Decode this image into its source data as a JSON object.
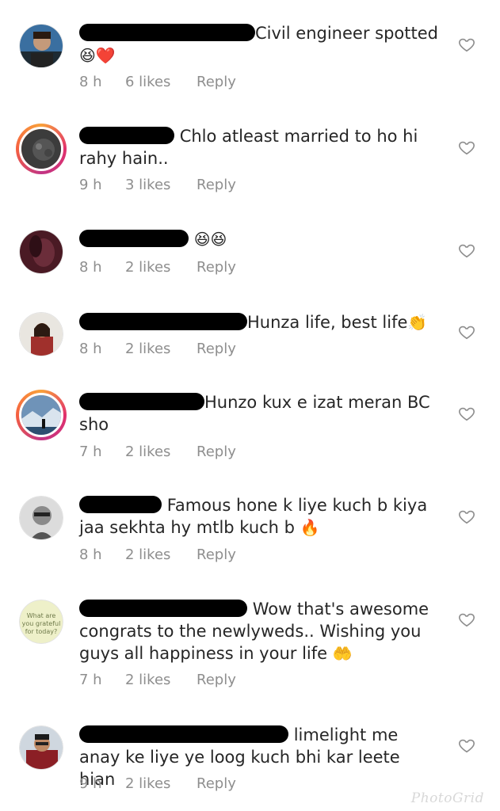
{
  "comments": [
    {
      "text": "Civil engineer spotted",
      "emoji": "😆❤️",
      "time": "8 h",
      "likes": "6 likes",
      "reply": "Reply"
    },
    {
      "text": "Chlo atleast married to ho hi rahy hain..",
      "emoji": "",
      "time": "9 h",
      "likes": "3 likes",
      "reply": "Reply"
    },
    {
      "text": "",
      "emoji": "😆😆",
      "time": "8 h",
      "likes": "2 likes",
      "reply": "Reply"
    },
    {
      "text": "Hunza life, best life",
      "emoji": "👏",
      "time": "8 h",
      "likes": "2 likes",
      "reply": "Reply"
    },
    {
      "text": "Hunzo kux e izat meran BC sho",
      "emoji": "",
      "time": "7 h",
      "likes": "2 likes",
      "reply": "Reply"
    },
    {
      "text": "Famous hone k liye kuch b kiya jaa sekhta hy mtlb kuch b",
      "emoji": "🔥",
      "time": "8 h",
      "likes": "2 likes",
      "reply": "Reply"
    },
    {
      "text": "Wow that's awesome congrats to the newlyweds.. Wishing you guys all happiness in your life",
      "emoji": "🤲",
      "time": "7 h",
      "likes": "2 likes",
      "reply": "Reply"
    },
    {
      "text": "limelight me anay ke liye ye loog kuch bhi kar leete hian",
      "emoji": "",
      "time": "9 h",
      "likes": "2 likes",
      "reply": "Reply"
    }
  ],
  "avatar_texts": [
    "What are",
    "you grateful",
    "for today?"
  ],
  "watermark": "PhotoGrid",
  "icons": {
    "like": "heart-outline-icon"
  },
  "colors": {
    "meta": "#8e8e8e",
    "text": "#262626",
    "ring": "#e1306c"
  }
}
